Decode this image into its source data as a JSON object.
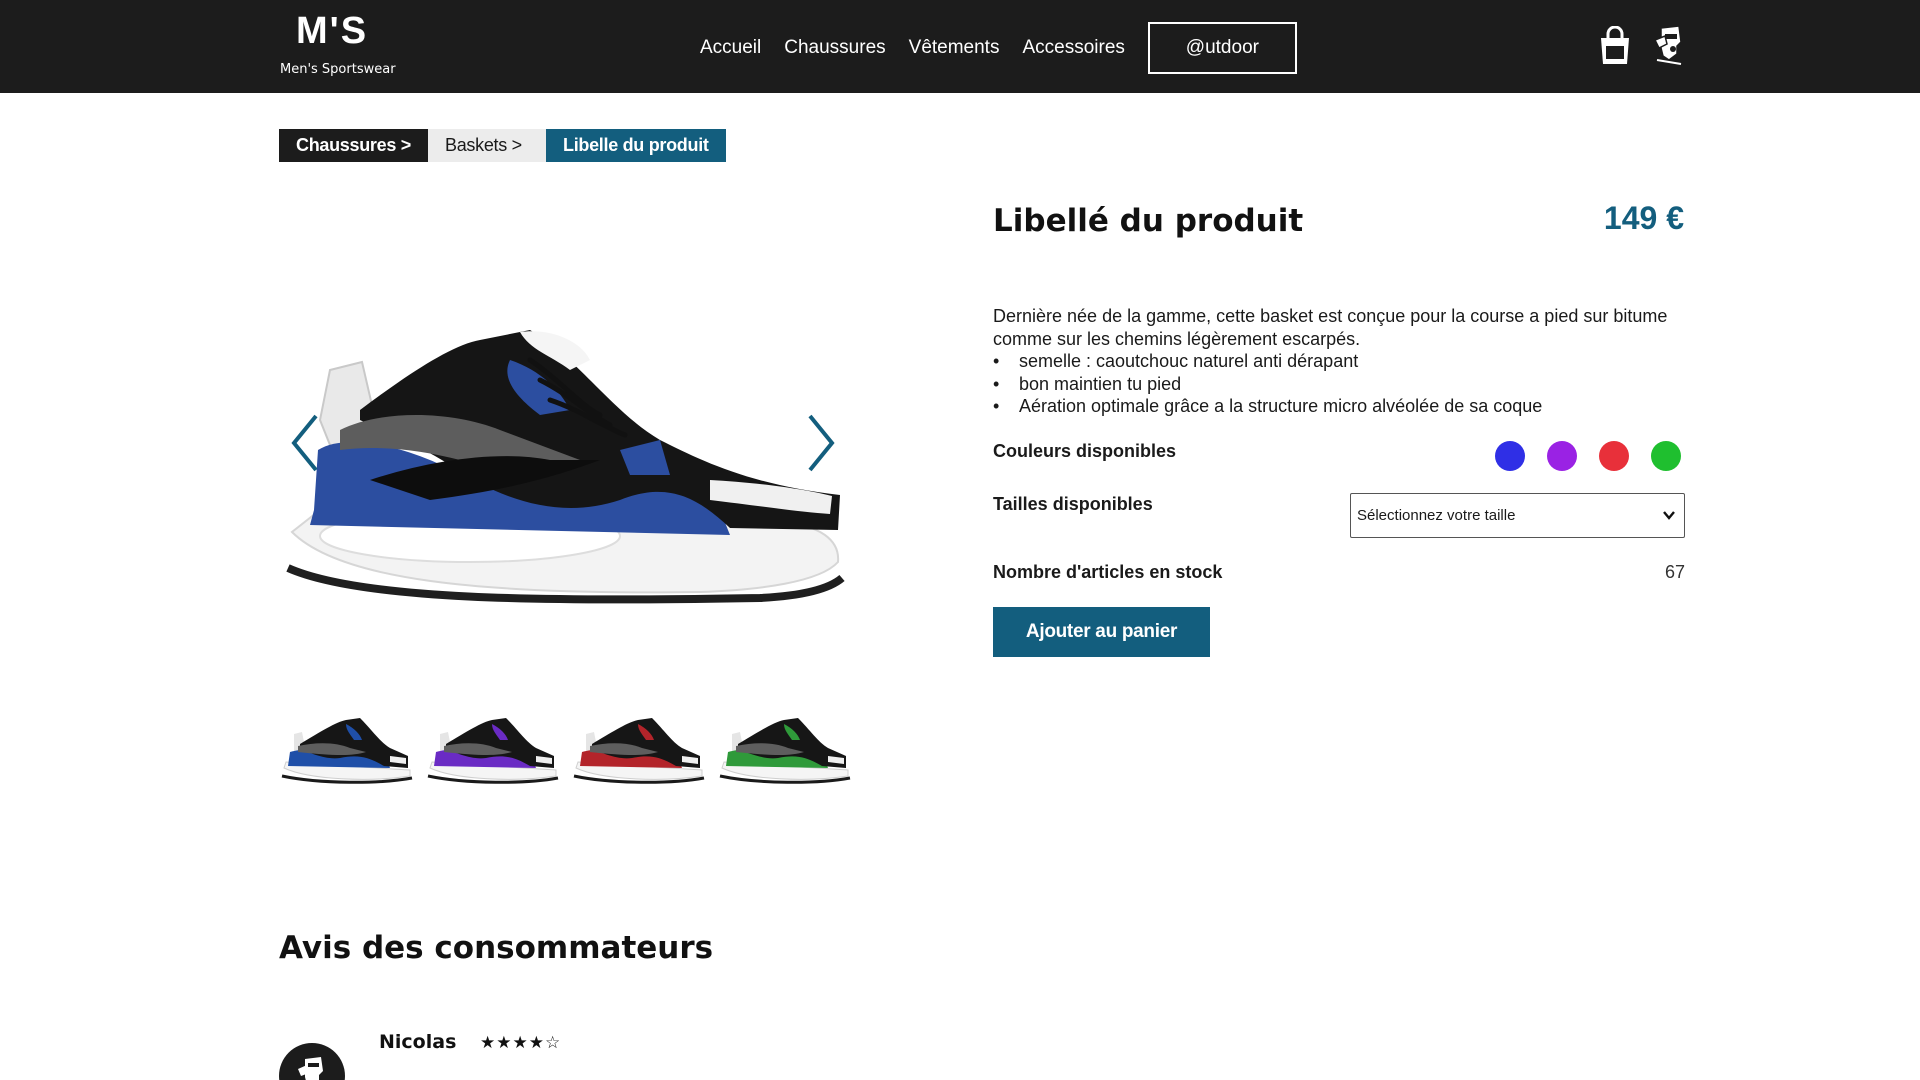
{
  "brand": {
    "logo_mark": "M'S",
    "name": "Men's Sportswear"
  },
  "nav": {
    "items": [
      "Accueil",
      "Chaussures",
      "Vêtements",
      "Accessoires"
    ],
    "outdoor_label": "@utdoor"
  },
  "header_icons": {
    "cart": "shopping-bag-icon",
    "account": "user-avatar-icon"
  },
  "breadcrumb": [
    "Chaussures >",
    "Baskets >",
    "Libelle du produit"
  ],
  "product": {
    "title": "Libellé du produit",
    "price": "149 €",
    "description": "Dernière née de la gamme, cette basket est conçue pour la course a pied sur bitume comme sur les chemins légèrement escarpés.",
    "features": [
      "semelle : caoutchouc naturel anti dérapant",
      "bon maintien tu pied",
      "Aération optimale grâce a la structure micro alvéolée de sa coque"
    ],
    "colors_label": "Couleurs disponibles",
    "colors": [
      "#2f2fe6",
      "#9a22e4",
      "#e8303a",
      "#1fbf2f"
    ],
    "sizes_label": "Tailles disponibles",
    "size_select": "Sélectionnez votre taille",
    "stock_label": "Nombre d'articles en stock",
    "stock_value": "67",
    "add_to_cart": "Ajouter au panier",
    "thumbnail_accents": [
      "#1f4fa8",
      "#6a2bc4",
      "#b3242a",
      "#2f9a3a"
    ],
    "main_accent": "#2c4ea0"
  },
  "reviews": {
    "title": "Avis des consommateurs",
    "items": [
      {
        "name": "Nicolas",
        "stars": "★★★★☆"
      }
    ]
  },
  "theme": {
    "header_bg": "#1c1c1c",
    "accent": "#135e7e"
  }
}
